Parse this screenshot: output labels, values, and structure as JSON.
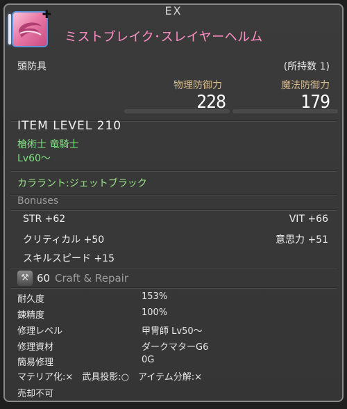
{
  "header": {
    "ex_label": "EX"
  },
  "item": {
    "name": "ミストブレイク･スレイヤーヘルム",
    "category": "頭防具",
    "owned": "(所持数 1)",
    "icon": "helm-icon",
    "name_color": "#ff8fc4"
  },
  "stats": {
    "physical_label": "物理防御力",
    "physical_value": "228",
    "magic_label": "魔法防御力",
    "magic_value": "179"
  },
  "item_level": "ITEM LEVEL 210",
  "jobs": "槍術士 竜騎士",
  "level_req": "Lv60～",
  "dye": "カララント:ジェットブラック",
  "bonuses": {
    "title": "Bonuses",
    "items": [
      "STR +62",
      "VIT +66",
      "クリティカル +50",
      "意思力 +51",
      "スキルスピード +15"
    ]
  },
  "craft": {
    "level": "60",
    "title": "Craft & Repair",
    "icon": "hammer-icon",
    "rows": [
      {
        "label": "耐久度",
        "value": "153%"
      },
      {
        "label": "錬精度",
        "value": "100%"
      },
      {
        "label": "修理レベル",
        "value": "甲冑師 Lv50～"
      },
      {
        "label": "修理資材",
        "value": "ダークマターG6"
      },
      {
        "label": "簡易修理",
        "value": "0G"
      }
    ]
  },
  "flags": "マテリア化:×　武具投影:○　アイテム分解:×",
  "sell": "売却不可"
}
